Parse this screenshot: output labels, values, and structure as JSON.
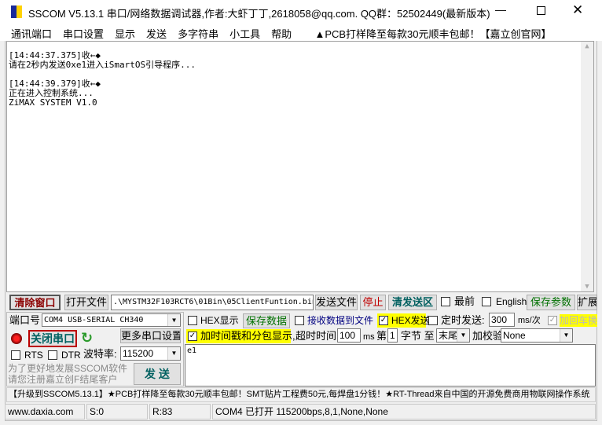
{
  "window": {
    "title": "SSCOM V5.13.1 串口/网络数据调试器,作者:大虾丁丁,2618058@qq.com. QQ群：52502449(最新版本)"
  },
  "menu": {
    "items": [
      "通讯端口",
      "串口设置",
      "显示",
      "发送",
      "多字符串",
      "小工具",
      "帮助"
    ],
    "ad": "▲PCB打样降至每款30元顺丰包邮！【嘉立创官网】"
  },
  "receive": {
    "lines": [
      "[14:44:37.375]收←◆",
      "请在2秒内发送0xe1进入iSmartOS引导程序...",
      "",
      "[14:44:39.379]收←◆",
      "正在进入控制系统...",
      "ZiMAX SYSTEM V1.0"
    ]
  },
  "toolbar": {
    "clear": "清除窗口",
    "open_file": "打开文件",
    "file_path": ".\\MYSTM32F103RCT6\\01Bin\\05ClientFuntion.bin",
    "send_file": "发送文件",
    "stop": "停止",
    "clear_send": "清发送区",
    "topmost": "最前",
    "english": "English",
    "save_params": "保存参数",
    "expand": "扩展"
  },
  "port": {
    "label": "端口号",
    "value": "COM4 USB-SERIAL CH340",
    "close_port": "关闭串口",
    "more_settings": "更多串口设置",
    "rts": "RTS",
    "dtr": "DTR",
    "baud_label": "波特率:",
    "baud": "115200",
    "promo1": "为了更好地发展SSCOM软件",
    "promo2": "请您注册嘉立创F结尾客户",
    "send": "发 送"
  },
  "options": {
    "hex_display": "HEX显示",
    "save_data": "保存数据",
    "recv_to_file": "接收数据到文件",
    "hex_send": "HEX发送",
    "timed_send": "定时发送:",
    "interval": "300",
    "interval_unit": "ms/次",
    "add_crlf": "加回车换行",
    "timestamp": "加时间戳和分包显示,",
    "timeout_label": "超时时间:",
    "timeout": "100",
    "timeout_unit": "ms",
    "byte_from_label": "第",
    "byte_from": "1",
    "byte_label": "字节 至",
    "byte_to": "末尾",
    "checksum_label": "加校验",
    "checksum": "None"
  },
  "send_text": "e1",
  "marquee": "【升级到SSCOM5.13.1】★PCB打样降至每款30元顺丰包邮！SMT贴片工程费50元,每焊盘1分钱！★RT-Thread来自中国的开源免费商用物联网操作系统",
  "status": {
    "site": "www.daxia.com",
    "sent": "S:0",
    "received": "R:83",
    "port_state": "COM4 已打开  115200bps,8,1,None,None"
  }
}
